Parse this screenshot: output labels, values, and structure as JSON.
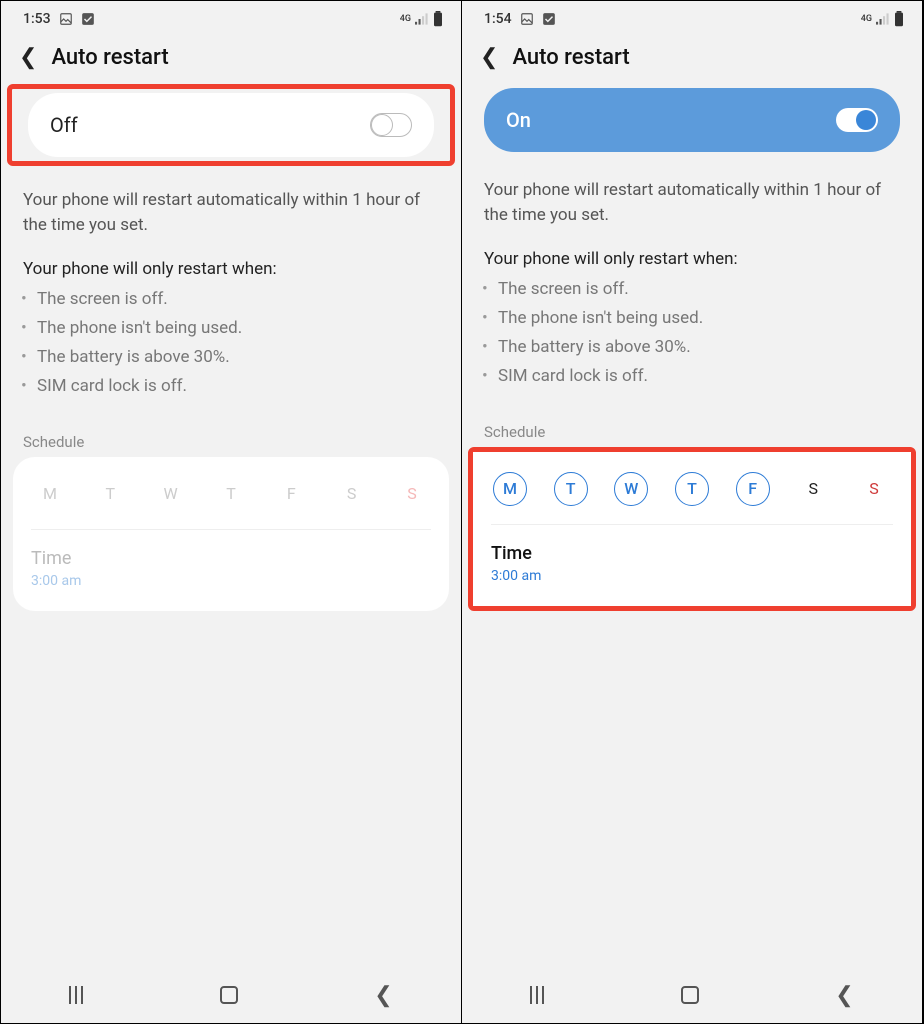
{
  "left": {
    "status": {
      "time": "1:53",
      "network": "4G"
    },
    "header": {
      "title": "Auto restart"
    },
    "toggle": {
      "label": "Off",
      "on": false
    },
    "desc": "Your phone will restart automatically within 1 hour of the time you set.",
    "cond_title": "Your phone will only restart when:",
    "conds": [
      "The screen is off.",
      "The phone isn't being used.",
      "The battery is above 30%.",
      "SIM card lock is off."
    ],
    "schedule_label": "Schedule",
    "days": [
      "M",
      "T",
      "W",
      "T",
      "F",
      "S",
      "S"
    ],
    "time_label": "Time",
    "time_value": "3:00 am"
  },
  "right": {
    "status": {
      "time": "1:54",
      "network": "4G"
    },
    "header": {
      "title": "Auto restart"
    },
    "toggle": {
      "label": "On",
      "on": true
    },
    "desc": "Your phone will restart automatically within 1 hour of the time you set.",
    "cond_title": "Your phone will only restart when:",
    "conds": [
      "The screen is off.",
      "The phone isn't being used.",
      "The battery is above 30%.",
      "SIM card lock is off."
    ],
    "schedule_label": "Schedule",
    "days": [
      "M",
      "T",
      "W",
      "T",
      "F",
      "S",
      "S"
    ],
    "days_selected": [
      true,
      true,
      true,
      true,
      true,
      false,
      false
    ],
    "time_label": "Time",
    "time_value": "3:00 am"
  }
}
